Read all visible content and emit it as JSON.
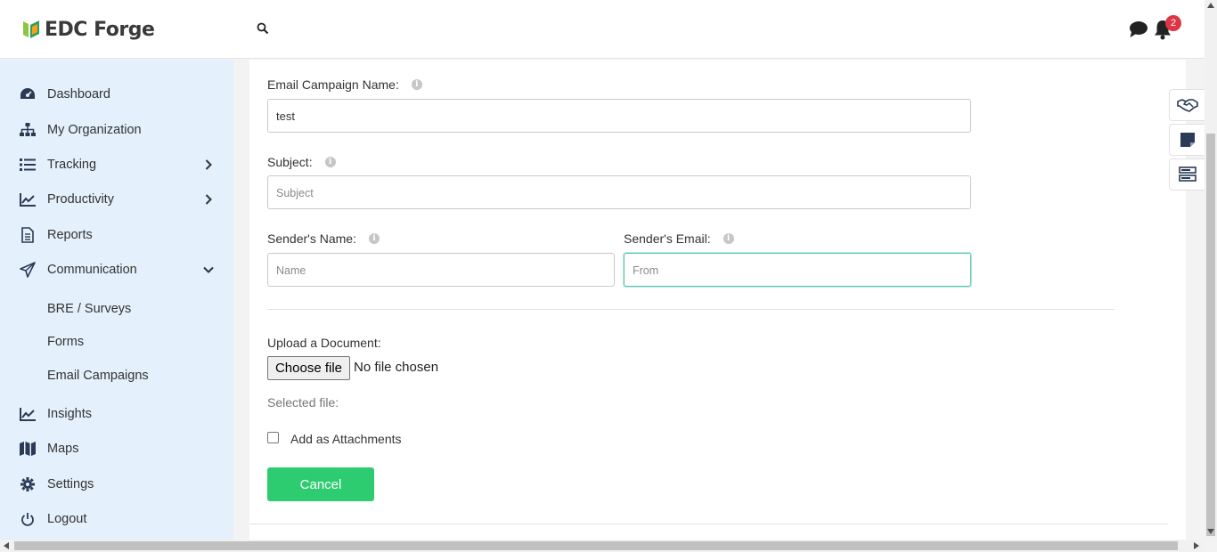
{
  "app": {
    "logo_text": "EDC Forge"
  },
  "header": {
    "notification_count": "2"
  },
  "sidebar": {
    "items": [
      {
        "label": "Dashboard"
      },
      {
        "label": "My Organization"
      },
      {
        "label": "Tracking"
      },
      {
        "label": "Productivity"
      },
      {
        "label": "Reports"
      },
      {
        "label": "Communication"
      },
      {
        "label": "Insights"
      },
      {
        "label": "Maps"
      },
      {
        "label": "Settings"
      },
      {
        "label": "Logout"
      }
    ],
    "communication_sub": [
      {
        "label": "BRE / Surveys"
      },
      {
        "label": "Forms"
      },
      {
        "label": "Email Campaigns"
      }
    ]
  },
  "form": {
    "campaign_name_label": "Email Campaign Name:",
    "campaign_name_value": "test",
    "subject_label": "Subject:",
    "subject_placeholder": "Subject",
    "sender_name_label": "Sender's Name:",
    "sender_name_placeholder": "Name",
    "sender_email_label": "Sender's Email:",
    "sender_email_placeholder": "From",
    "upload_label": "Upload a Document:",
    "choose_file_label": "Choose file",
    "no_file_text": "No file chosen",
    "selected_file_label": "Selected file:",
    "attachment_label": "Add as Attachments",
    "attachment_checked": false,
    "cancel_label": "Cancel"
  },
  "colors": {
    "accent_green": "#2ecc71",
    "sidebar_bg": "#e4f0fb",
    "badge_red": "#dc3545",
    "focus_border": "#5cc3b1"
  }
}
